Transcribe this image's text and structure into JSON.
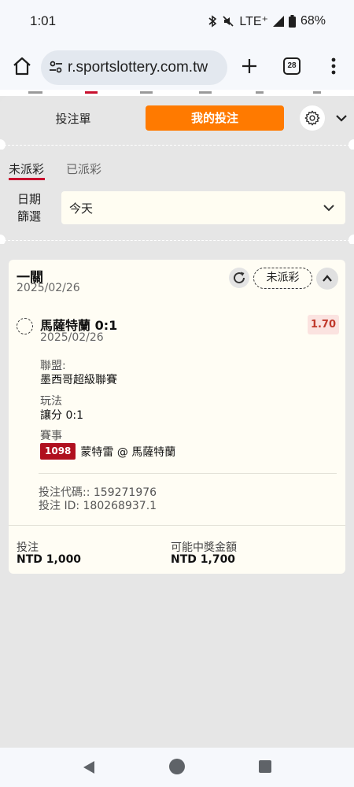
{
  "status_bar": {
    "time": "1:01",
    "network": "LTE⁺",
    "battery": "68%"
  },
  "browser": {
    "url": "r.sportslottery.com.tw",
    "tab_count": "28"
  },
  "panel": {
    "tab_betslip": "投注單",
    "tab_mybets": "我的投注",
    "sub_tabs": {
      "unsettled": "未派彩",
      "settled": "已派彩"
    },
    "date_filter_label": "日期篩選",
    "date_filter_value": "今天"
  },
  "bet": {
    "title": "一關",
    "placed_date": "2025/02/26",
    "status": "未派彩",
    "selection": "馬薩特蘭 0:1",
    "selection_date": "2025/02/26",
    "odds": "1.70",
    "league_label": "聯盟:",
    "league_value": "墨西哥超級聯賽",
    "market_label": "玩法",
    "market_value": "讓分 0:1",
    "event_label": "賽事",
    "event_code": "1098",
    "event_name": "蒙特雷 @ 馬薩特蘭",
    "bet_code": "投注代碼:: 159271976",
    "bet_id": "投注 ID: 180268937.1",
    "stake_label": "投注",
    "stake_value": "NTD 1,000",
    "payout_label": "可能中獎金額",
    "payout_value": "NTD 1,700"
  },
  "colors": {
    "accent": "#ff7a00",
    "danger": "#c0392b",
    "code_badge": "#b0101e"
  }
}
